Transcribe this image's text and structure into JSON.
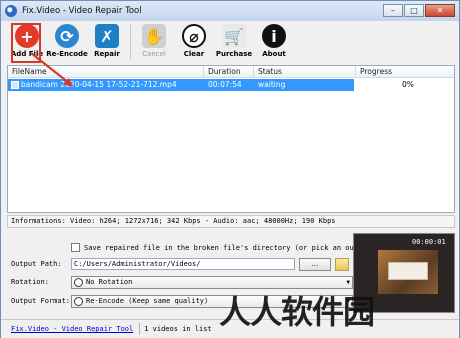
{
  "window": {
    "title": "Fix.Video - Video Repair Tool"
  },
  "toolbar": {
    "add_file": "Add File",
    "re_encode": "Re-Encode",
    "repair": "Repair",
    "cancel": "Cancel",
    "clear": "Clear",
    "purchase": "Purchase",
    "about": "About"
  },
  "list": {
    "columns": {
      "filename": "FileName",
      "duration": "Duration",
      "status": "Status",
      "progress": "Progress"
    },
    "rows": [
      {
        "filename": "bandicam 2020-04-15 17-52-21-712.mp4",
        "duration": "00:07:54",
        "status": "waiting",
        "progress": "0%"
      }
    ]
  },
  "info": {
    "text": "Informations:  Video: h264; 1272x716; 342 Kbps - Audio: aac; 48000Hz; 190 Kbps"
  },
  "settings": {
    "save_in_broken_dir": "Save repaired file in the broken file's directory (or pick an output p",
    "output_path_label": "Output Path:",
    "output_path_value": "C:/Users/Administrator/Videos/",
    "browse_label": "...",
    "rotation_label": "Rotation:",
    "rotation_value": "No Rotation",
    "output_format_label": "Output Format:",
    "output_format_value": "Re-Encode (Keep same quality)"
  },
  "preview": {
    "time": "00:00:01"
  },
  "status": {
    "link": "Fix.Video - Video Repair Tool",
    "count": "1 videos in list"
  },
  "watermark": {
    "text": "人人软件园"
  },
  "colors": {
    "selection": "#3399ff",
    "add_icon": "#e03a2a",
    "highlight_box": "#d43a2c"
  }
}
